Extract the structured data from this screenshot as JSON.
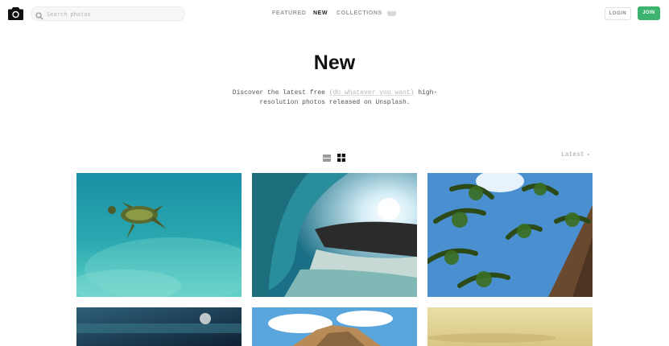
{
  "header": {
    "logo_icon": "camera-icon",
    "search": {
      "placeholder": "Search photos",
      "value": "",
      "icon": "search-icon"
    },
    "nav": [
      {
        "label": "FEATURED",
        "active": false
      },
      {
        "label": "NEW",
        "active": true
      },
      {
        "label": "COLLECTIONS",
        "active": false
      }
    ],
    "more_label": "•••",
    "login_label": "LOGIN",
    "join_label": "JOIN"
  },
  "hero": {
    "title": "New",
    "description_before": "Discover the latest free ",
    "description_link": "(do whatever you want)",
    "description_after": " high-resolution photos released on Unsplash."
  },
  "toolbar": {
    "list_view_icon": "list-view-icon",
    "grid_view_icon": "grid-view-icon",
    "sort_label": "Latest",
    "sort_icon": "caret-down-icon"
  },
  "photos": [
    {
      "subject": "sea turtle underwater"
    },
    {
      "subject": "breaking wave barrel"
    },
    {
      "subject": "palm trees from below"
    },
    {
      "subject": "blurred dark blue scene"
    },
    {
      "subject": "mountain cliff with clouds"
    },
    {
      "subject": "hazy beach horizon"
    }
  ],
  "colors": {
    "accent_green": "#3cb46e",
    "nav_active": "#222222",
    "nav_inactive": "#9a9a9a"
  }
}
